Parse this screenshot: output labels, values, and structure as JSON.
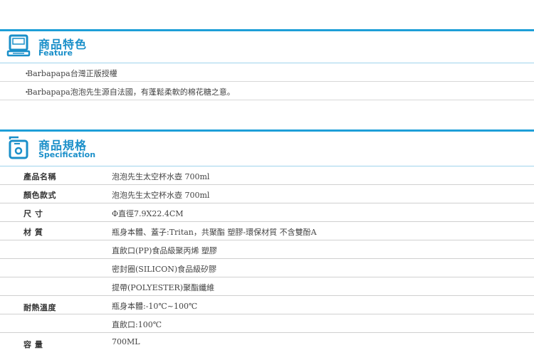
{
  "feature": {
    "title_zh": "商品特色",
    "title_en": "Feature",
    "icon": "monitor-icon",
    "items": [
      {
        "bullet": "・",
        "text": "Barbapapa台灣正版授權"
      },
      {
        "bullet": "・",
        "text": "Barbapapa泡泡先生源自法國，有蓬鬆柔軟的棉花糖之意。"
      }
    ]
  },
  "spec": {
    "title_zh": "商品規格",
    "title_en": "Specification",
    "icon": "device-icon",
    "rows": [
      {
        "label": "產品名稱",
        "value": "泡泡先生太空杯水壺 700ml"
      },
      {
        "label": "顏色款式",
        "value": "泡泡先生太空杯水壺 700ml"
      },
      {
        "label": "尺 寸",
        "value": "Φ直徑7.9X22.4CM"
      },
      {
        "label": "材 質",
        "value": "瓶身本體、蓋子:Tritan，共聚酯 塑膠-環保材質 不含雙酚A"
      },
      {
        "label": "",
        "value": "直飲口(PP)食品級聚丙烯 塑膠"
      },
      {
        "label": "",
        "value": "密封圈(SILICON)食品級矽膠"
      },
      {
        "label": "",
        "value": "提帶(POLYESTER)聚酯纖維"
      },
      {
        "label": "耐熱溫度",
        "value": "瓶身本體:-10℃~100℃"
      },
      {
        "label": "",
        "value": "直飲口:100℃"
      },
      {
        "label": "容 量",
        "value": "700ML"
      }
    ]
  },
  "colors": {
    "accent": "#1e9fd8",
    "title": "#1a8fc9"
  }
}
